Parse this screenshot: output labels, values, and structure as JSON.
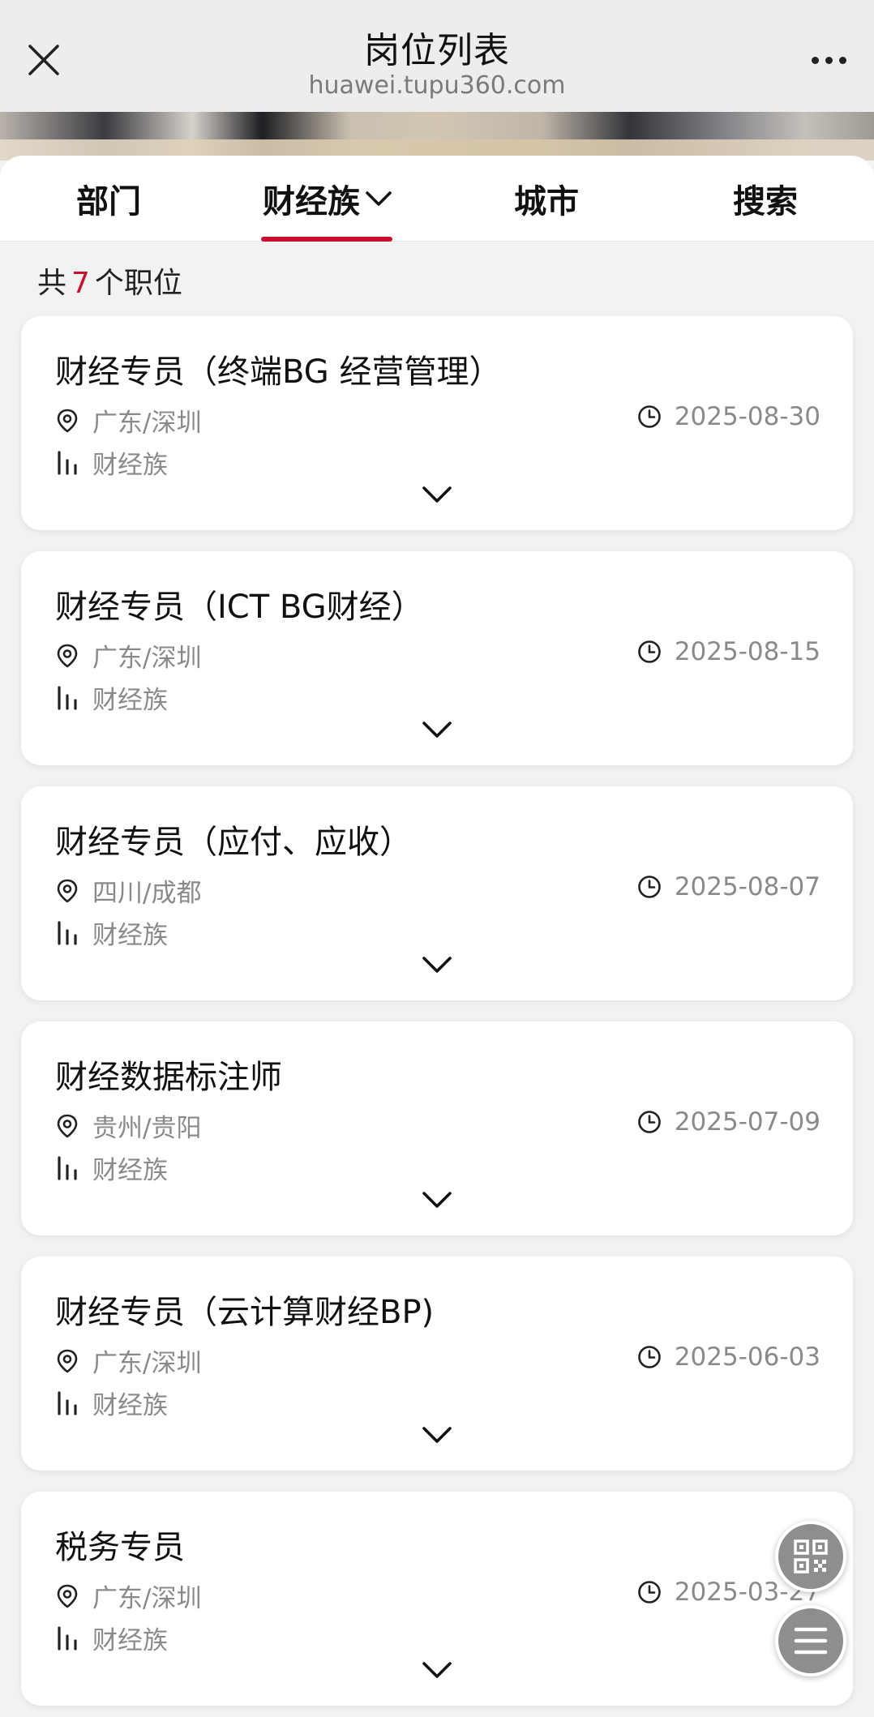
{
  "nav": {
    "title": "岗位列表",
    "url": "huawei.tupu360.com"
  },
  "tabs": [
    {
      "label": "部门",
      "active": false,
      "has_dropdown": false
    },
    {
      "label": "财经族",
      "active": true,
      "has_dropdown": true
    },
    {
      "label": "城市",
      "active": false,
      "has_dropdown": false
    },
    {
      "label": "搜索",
      "active": false,
      "has_dropdown": false
    }
  ],
  "summary": {
    "prefix": "共",
    "count": "7",
    "suffix": "个职位"
  },
  "jobs": [
    {
      "title": "财经专员（终端BG 经营管理）",
      "location": "广东/深圳",
      "date": "2025-08-30",
      "family": "财经族"
    },
    {
      "title": "财经专员（ICT BG财经）",
      "location": "广东/深圳",
      "date": "2025-08-15",
      "family": "财经族"
    },
    {
      "title": "财经专员（应付、应收）",
      "location": "四川/成都",
      "date": "2025-08-07",
      "family": "财经族"
    },
    {
      "title": "财经数据标注师",
      "location": "贵州/贵阳",
      "date": "2025-07-09",
      "family": "财经族"
    },
    {
      "title": "财经专员（云计算财经BP)",
      "location": "广东/深圳",
      "date": "2025-06-03",
      "family": "财经族"
    },
    {
      "title": "税务专员",
      "location": "广东/深圳",
      "date": "2025-03-27",
      "family": "财经族"
    }
  ],
  "icons": {
    "close": "close-icon",
    "more": "more-icon",
    "location": "location-pin-icon",
    "clock": "clock-icon",
    "family": "bar-chart-icon",
    "expand": "chevron-down-icon",
    "qr": "qr-code-icon",
    "menu": "menu-icon"
  },
  "colors": {
    "accent": "#c8102e",
    "meta_text": "#8a8a8a",
    "page_bg": "#f2f2f2"
  }
}
